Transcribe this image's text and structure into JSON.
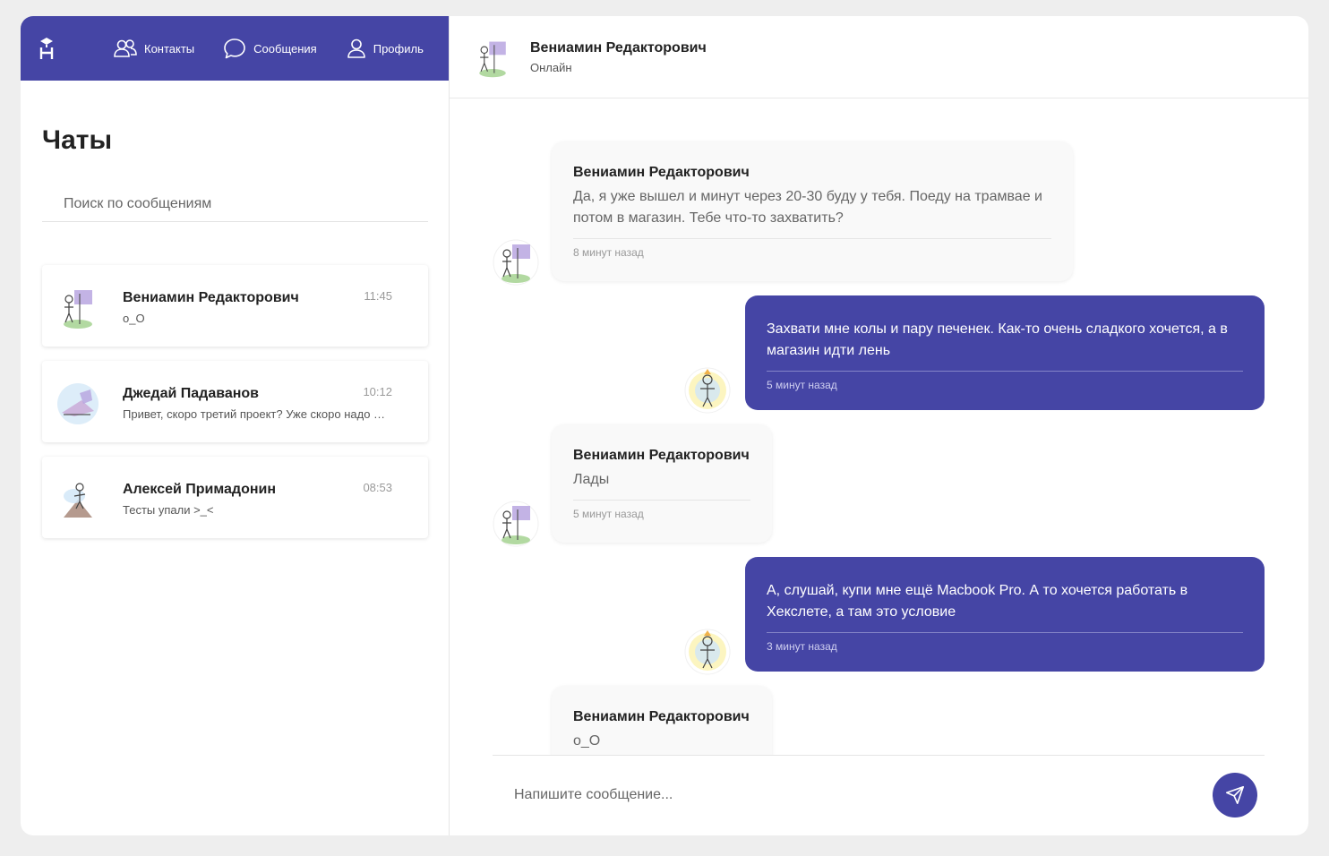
{
  "nav": {
    "contacts": "Контакты",
    "messages": "Сообщения",
    "profile": "Профиль"
  },
  "sidebar": {
    "title": "Чаты",
    "search_placeholder": "Поиск по сообщениям",
    "chats": [
      {
        "name": "Вениамин Редакторович",
        "time": "11:45",
        "preview": "o_O"
      },
      {
        "name": "Джедай Падаванов",
        "time": "10:12",
        "preview": "Привет, скоро третий проект? Уже скоро надо было бы начать"
      },
      {
        "name": "Алексей Примадонин",
        "time": "08:53",
        "preview": "Тесты упали >_<"
      }
    ]
  },
  "chat": {
    "name": "Вениамин Редакторович",
    "status": "Онлайн",
    "messages": [
      {
        "direction": "in",
        "author": "Вениамин Редакторович",
        "text": "Да, я уже вышел и минут через 20-30 буду у тебя. Поеду на трамвае и потом в магазин. Тебе что-то захватить?",
        "time": "8 минут назад"
      },
      {
        "direction": "out",
        "text": "Захвати мне колы и пару печенек. Как-то очень сладкого хочется, а в магазин идти лень",
        "time": "5 минут назад"
      },
      {
        "direction": "in",
        "author": "Вениамин Редакторович",
        "text": "Лады",
        "time": "5 минут назад"
      },
      {
        "direction": "out",
        "text": "А, слушай, купи мне ещё Macbook Pro. А то хочется работать в Хекслете, а там это условие",
        "time": "3 минут назад"
      },
      {
        "direction": "in",
        "author": "Вениамин Редакторович",
        "text": "o_O",
        "time": ""
      }
    ],
    "composer_placeholder": "Напишите сообщение..."
  },
  "colors": {
    "accent": "#4545a5",
    "background": "#eeeeee"
  }
}
